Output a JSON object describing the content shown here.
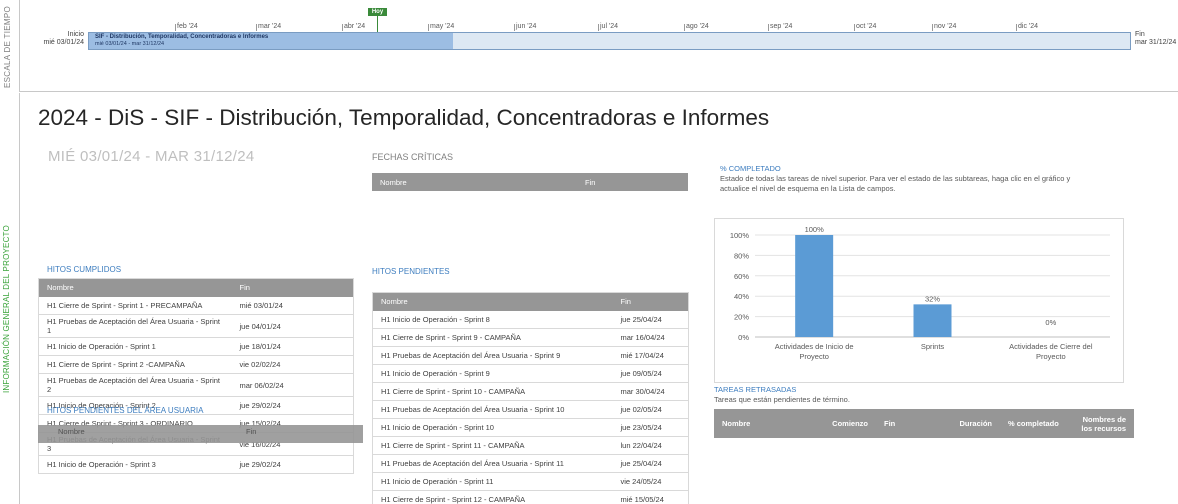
{
  "timeline": {
    "side_label": "ESCALA DE TIEMPO",
    "today_label": "Hoy",
    "start": {
      "label": "Inicio",
      "date": "mié 03/01/24"
    },
    "end": {
      "label": "Fin",
      "date": "mar 31/12/24"
    },
    "bar": {
      "title": "SIF - Distribución, Temporalidad, Concentradoras e Informes",
      "dates": "mié 03/01/24 - mar 31/12/24",
      "progress_fraction": 0.35
    },
    "months": [
      "feb '24",
      "mar '24",
      "abr '24",
      "may '24",
      "jun '24",
      "jul '24",
      "ago '24",
      "sep '24",
      "oct '24",
      "nov '24",
      "dic '24"
    ]
  },
  "report": {
    "side_label": "INFORMACIÓN GENERAL DEL PROYECTO",
    "title": "2024 - DiS - SIF - Distribución, Temporalidad, Concentradoras e Informes",
    "dates": "MIÉ 03/01/24 -  MAR 31/12/24",
    "critical_dates": {
      "label": "FECHAS CRÍTICAS",
      "headers": [
        "Nombre",
        "Fin"
      ]
    },
    "milestones_done": {
      "label": "HITOS CUMPLIDOS",
      "headers": [
        "Nombre",
        "Fin"
      ],
      "rows": [
        [
          "H1 Cierre de Sprint - Sprint 1 - PRECAMPAÑA",
          "mié 03/01/24"
        ],
        [
          "H1 Pruebas de Aceptación del Área Usuaria - Sprint 1",
          "jue 04/01/24"
        ],
        [
          "H1 Inicio de Operación - Sprint 1",
          "jue 18/01/24"
        ],
        [
          "H1 Cierre de Sprint - Sprint 2 -CAMPAÑA",
          "vie 02/02/24"
        ],
        [
          "H1 Pruebas de Aceptación del Área Usuaria - Sprint 2",
          "mar 06/02/24"
        ],
        [
          "H1 Inicio de Operación - Sprint 2",
          "jue 29/02/24"
        ],
        [
          "H1 Cierre de Sprint - Sprint 3 - ORDINARIO",
          "jue 15/02/24"
        ],
        [
          "H1 Pruebas de Aceptación del Área Usuaria - Sprint 3",
          "vie 16/02/24"
        ],
        [
          "H1 Inicio de Operación - Sprint 3",
          "jue 29/02/24"
        ]
      ]
    },
    "user_pending": {
      "label": "HITOS PENDIENTES DEL ÁREA USUARIA",
      "headers": [
        "Nombre",
        "Fin"
      ]
    },
    "milestones_pending": {
      "label": "HITOS PENDIENTES",
      "headers": [
        "Nombre",
        "Fin"
      ],
      "rows": [
        [
          "H1 Inicio de Operación - Sprint 8",
          "jue 25/04/24"
        ],
        [
          "H1 Cierre de Sprint - Sprint 9 - CAMPAÑA",
          "mar 16/04/24"
        ],
        [
          "H1 Pruebas de Aceptación del Área Usuaria - Sprint 9",
          "mié 17/04/24"
        ],
        [
          "H1 Inicio de Operación - Sprint 9",
          "jue 09/05/24"
        ],
        [
          "H1 Cierre de Sprint - Sprint 10 - CAMPAÑA",
          "mar 30/04/24"
        ],
        [
          "H1 Pruebas de Aceptación del Área Usuaria - Sprint 10",
          "jue 02/05/24"
        ],
        [
          "H1 Inicio de Operación - Sprint 10",
          "jue 23/05/24"
        ],
        [
          "H1 Cierre de Sprint - Sprint 11 - CAMPAÑA",
          "lun 22/04/24"
        ],
        [
          "H1 Pruebas de Aceptación del Área Usuaria - Sprint 11",
          "jue 25/04/24"
        ],
        [
          "H1 Inicio de Operación - Sprint 11",
          "vie 24/05/24"
        ],
        [
          "H1 Cierre de Sprint - Sprint 12 - CAMPAÑA",
          "mié 15/05/24"
        ]
      ]
    },
    "percent_complete": {
      "label": "% COMPLETADO",
      "description": "Estado de todas las tareas de nivel superior. Para ver el estado de las subtareas, haga clic en el gráfico y actualice el nivel de esquema en la Lista de campos."
    },
    "late_tasks": {
      "label": "TAREAS RETRASADAS",
      "description": "Tareas que están pendientes de término.",
      "headers": [
        "Nombre",
        "Comienzo",
        "Fin",
        "Duración",
        "% completado",
        "Nombres de los recursos"
      ]
    }
  },
  "chart_data": {
    "type": "bar",
    "categories": [
      "Actividades de Inicio de Proyecto",
      "Sprints",
      "Actividades de Cierre del Proyecto"
    ],
    "values": [
      100,
      32,
      0
    ],
    "value_labels": [
      "100%",
      "32%",
      "0%"
    ],
    "ylim": [
      0,
      100
    ],
    "yticks": [
      "0%",
      "20%",
      "40%",
      "60%",
      "80%",
      "100%"
    ],
    "grid": true,
    "bar_color": "#5b9bd5"
  }
}
